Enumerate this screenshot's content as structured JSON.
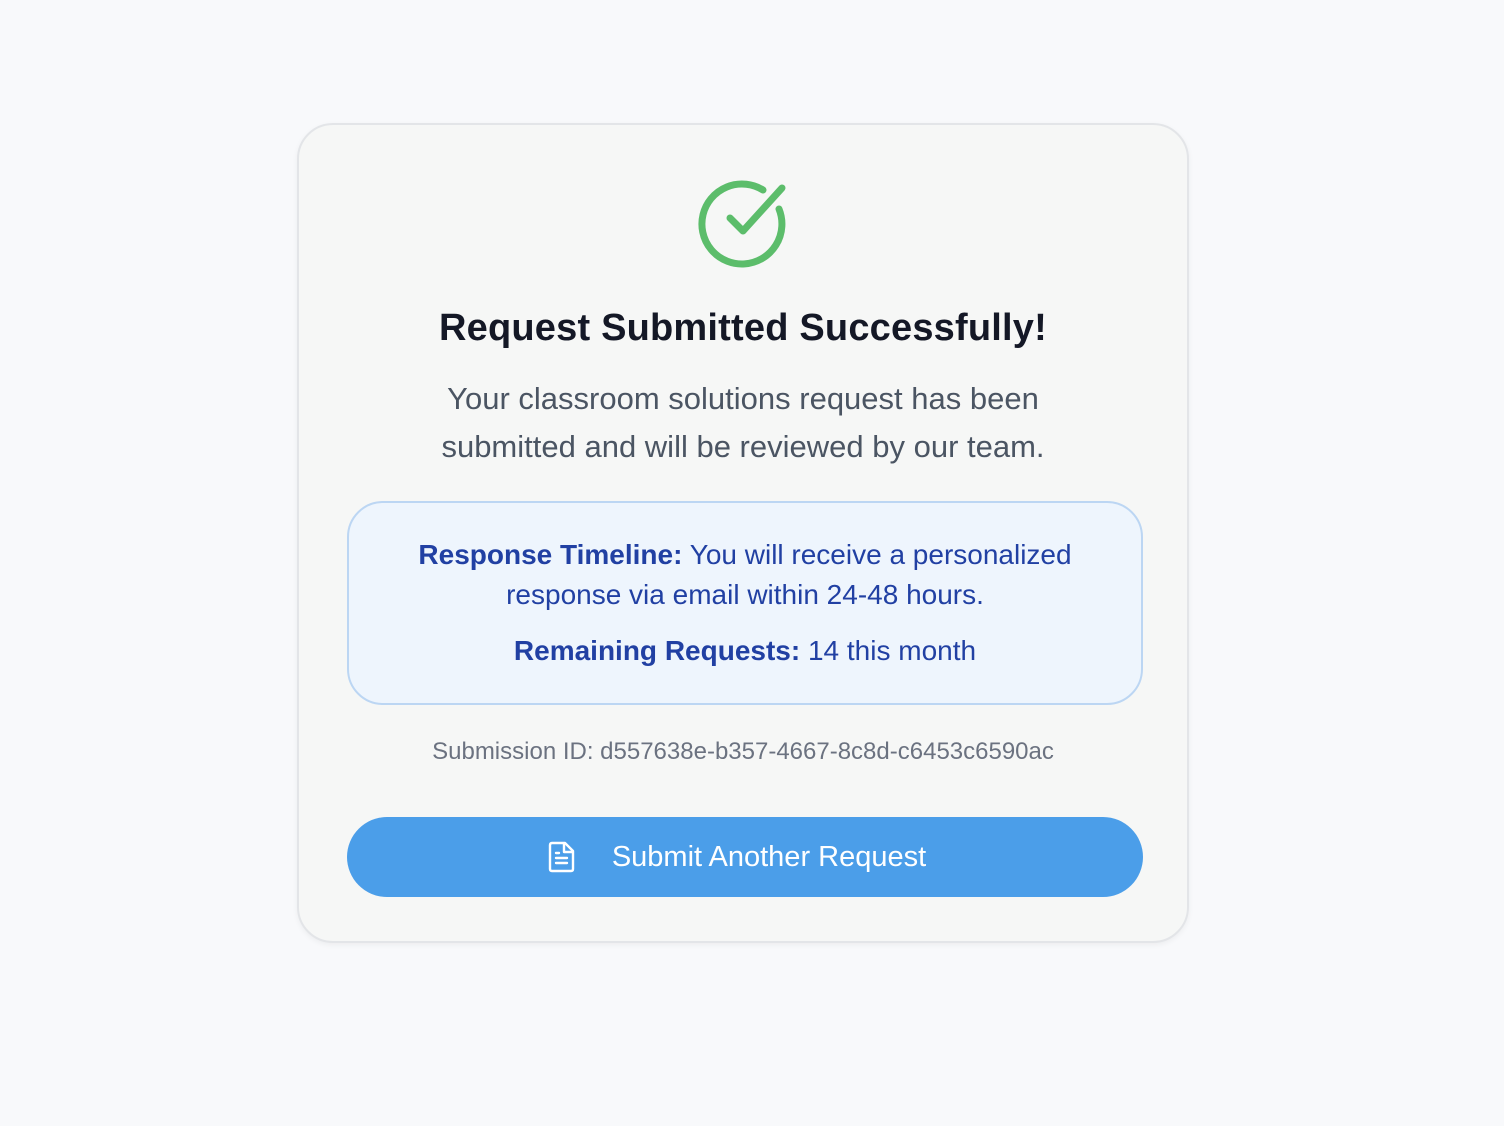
{
  "confirmation": {
    "icon": "check-circle-icon",
    "title": "Request Submitted Successfully!",
    "message": "Your classroom solutions request has been submitted and will be reviewed by our team.",
    "timeline_label": "Response Timeline:",
    "timeline_text": "You will receive a personalized response via email within 24-48 hours.",
    "remaining_label": "Remaining Requests:",
    "remaining_text": "14 this month",
    "submission_id": "Submission ID: d557638e-b357-4667-8c8d-c6453c6590ac",
    "button_label": "Submit Another Request",
    "button_icon": "document-icon"
  },
  "colors": {
    "success": "#5cbd6b",
    "accent": "#4b9ee9",
    "info_text": "#2140a3",
    "info_bg": "#eef5fd"
  }
}
